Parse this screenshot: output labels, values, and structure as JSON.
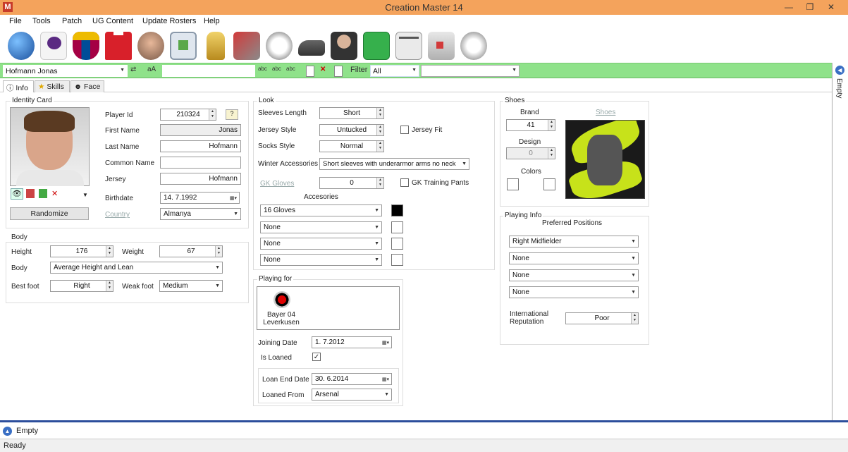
{
  "window": {
    "title": "Creation Master 14",
    "app_icon": "M",
    "minimize": "—",
    "maximize": "❐",
    "close": "✕"
  },
  "menu": [
    "File",
    "Tools",
    "Patch",
    "UG Content",
    "Update Rosters",
    "Help"
  ],
  "toolbar_icons": [
    "globe-icon",
    "premier-league-icon",
    "fc-barcelona-icon",
    "jersey-icon",
    "player-face-icon",
    "stadium-icon",
    "trophy-icon",
    "stands-icon",
    "ball-icon",
    "boots-icon",
    "manager-icon",
    "pitch-icon",
    "newspaper-icon",
    "goalkeeper-gloves-icon",
    "headphones-icon"
  ],
  "search_bar": {
    "player_select": "Hofmann Jonas",
    "btn_a": "aA",
    "filter_label": "Filter",
    "filter_value": "All",
    "filter2_value": ""
  },
  "tabs": {
    "info": "Info",
    "skills": "Skills",
    "face": "Face"
  },
  "identity": {
    "group_title": "Identity Card",
    "player_id_label": "Player Id",
    "player_id": "210324",
    "first_name_label": "First Name",
    "first_name": "Jonas",
    "last_name_label": "Last Name",
    "last_name": "Hofmann",
    "common_name_label": "Common Name",
    "common_name": "",
    "jersey_label": "Jersey",
    "jersey": "Hofmann",
    "birthdate_label": "Birthdate",
    "birthdate": "14.  7.1992",
    "country_label": "Country",
    "country": "Almanya",
    "randomize": "Randomize"
  },
  "body": {
    "group_title": "Body",
    "height_label": "Height",
    "height": "176",
    "weight_label": "Weight",
    "weight": "67",
    "body_label": "Body",
    "body": "Average Height and Lean",
    "best_foot_label": "Best foot",
    "best_foot": "Right",
    "weak_foot_label": "Weak foot",
    "weak_foot": "Medium"
  },
  "look": {
    "group_title": "Look",
    "sleeves_label": "Sleeves Length",
    "sleeves": "Short",
    "jersey_style_label": "Jersey Style",
    "jersey_style": "Untucked",
    "jersey_fit_label": "Jersey Fit",
    "socks_label": "Socks Style",
    "socks": "Normal",
    "winter_label": "Winter Accessories",
    "winter": "Short sleeves with underarmor arms no neck",
    "gk_gloves_label": "GK Gloves",
    "gk_gloves": "0",
    "gk_pants_label": "GK Training Pants",
    "accessories_label": "Accesories",
    "accessories": [
      "16 Gloves",
      "None",
      "None",
      "None"
    ],
    "accessory_colors": [
      "#000000",
      "#ffffff",
      "#ffffff",
      "#ffffff"
    ]
  },
  "playing_for": {
    "group_title": "Playing for",
    "club": "Bayer 04 Leverkusen",
    "joining_date_label": "Joining Date",
    "joining_date": "1.  7.2012",
    "is_loaned_label": "Is Loaned",
    "is_loaned": "✓",
    "loan_end_label": "Loan End Date",
    "loan_end": "30.  6.2014",
    "loaned_from_label": "Loaned From",
    "loaned_from": "Arsenal"
  },
  "shoes": {
    "group_title": "Shoes",
    "brand_label": "Brand",
    "brand": "41",
    "design_label": "Design",
    "design": "0",
    "colors_label": "Colors",
    "shoes_link": "Shoes"
  },
  "playing_info": {
    "group_title": "Playing Info",
    "preferred_label": "Preferred Positions",
    "positions": [
      "Right Midfielder",
      "None",
      "None",
      "None"
    ],
    "reputation_label": "International Reputation",
    "reputation": "Poor"
  },
  "right_strip": {
    "label": "Empty"
  },
  "bottom_panel": {
    "label": "Empty"
  },
  "status": {
    "text": "Ready"
  }
}
